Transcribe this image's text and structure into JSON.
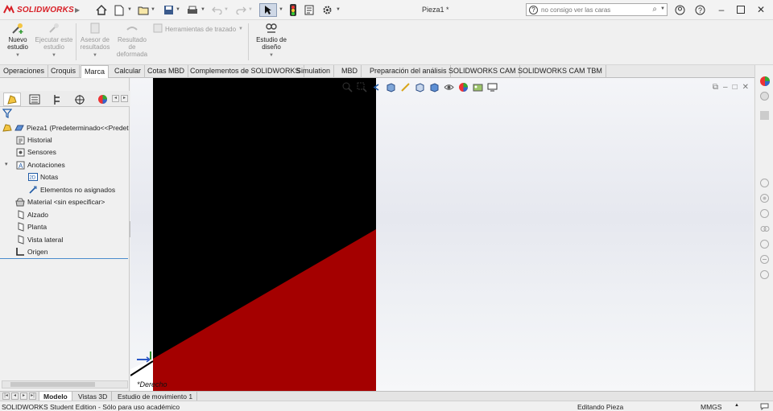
{
  "app": {
    "brand": "SOLIDWORKS",
    "document_title": "Pieza1 *",
    "brand_color": "#d81f26"
  },
  "titlebar": {
    "search_placeholder": "no consigo ver las caras"
  },
  "ribbon": {
    "buttons": [
      {
        "label_1": "Nuevo",
        "label_2": "estudio",
        "enabled": true
      },
      {
        "label_1": "Ejecutar este",
        "label_2": "estudio",
        "enabled": false
      },
      {
        "label_1": "Asesor de",
        "label_2": "resultados",
        "enabled": false
      },
      {
        "label_1": "Resultado",
        "label_2": "de",
        "label_3": "deformada",
        "enabled": false
      },
      {
        "label_1": "Herramientas de trazado",
        "enabled": false
      },
      {
        "label_1": "Estudio de",
        "label_2": "diseño",
        "enabled": true
      }
    ]
  },
  "tabs": [
    {
      "label": "Operaciones"
    },
    {
      "label": "Croquis"
    },
    {
      "label": "Marca",
      "active": true
    },
    {
      "label": "Calcular"
    },
    {
      "label": "Cotas MBD"
    },
    {
      "label": "Complementos de SOLIDWORKS"
    },
    {
      "label": "Simulation"
    },
    {
      "label": "MBD"
    },
    {
      "label": "Preparación del análisis"
    },
    {
      "label": "SOLIDWORKS CAM"
    },
    {
      "label": "SOLIDWORKS CAM TBM"
    }
  ],
  "tree": {
    "root": "Pieza1  (Predeterminado<<Predet",
    "items": [
      {
        "label": "Historial"
      },
      {
        "label": "Sensores"
      },
      {
        "label": "Anotaciones"
      },
      {
        "label": "Notas"
      },
      {
        "label": "Elementos no asignados"
      },
      {
        "label": "Material <sin especificar>"
      },
      {
        "label": "Alzado"
      },
      {
        "label": "Planta"
      },
      {
        "label": "Vista lateral"
      },
      {
        "label": "Origen"
      }
    ]
  },
  "viewport": {
    "view_name": "*Derecho"
  },
  "bottom_tabs": [
    {
      "label": "Modelo",
      "active": true
    },
    {
      "label": "Vistas 3D"
    },
    {
      "label": "Estudio de movimiento 1"
    }
  ],
  "status": {
    "edition": "SOLIDWORKS Student Edition - Sólo para uso académico",
    "mode": "Editando Pieza",
    "units": "MMGS"
  }
}
